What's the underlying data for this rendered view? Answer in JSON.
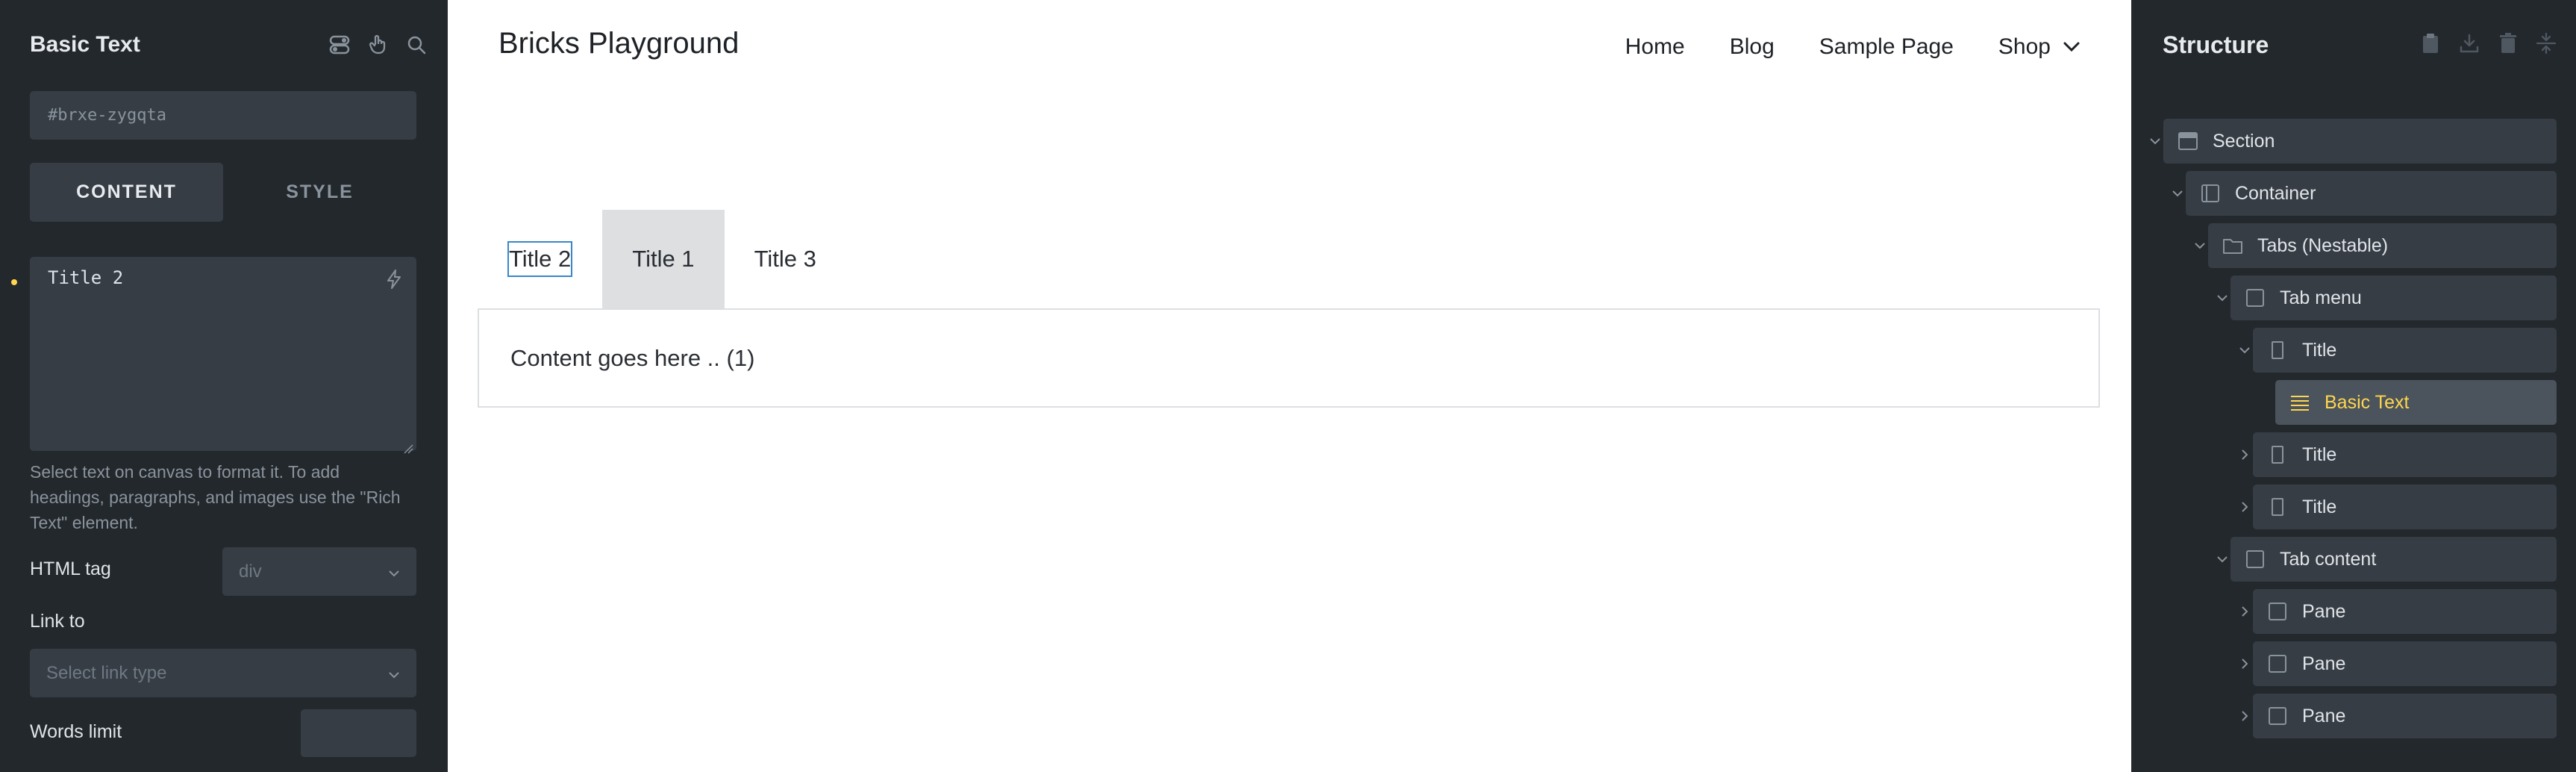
{
  "left_panel": {
    "title": "Basic Text",
    "id_placeholder": "#brxe-zygqta",
    "tabs": {
      "content": "CONTENT",
      "style": "STYLE"
    },
    "text_value": "Title 2",
    "help_text": "Select text on canvas to format it. To add headings, paragraphs, and images use the \"Rich Text\" element.",
    "html_tag_label": "HTML tag",
    "html_tag_value": "div",
    "link_to_label": "Link to",
    "link_type_placeholder": "Select link type",
    "words_limit_label": "Words limit"
  },
  "canvas": {
    "site_title": "Bricks Playground",
    "nav": [
      "Home",
      "Blog",
      "Sample Page",
      "Shop"
    ],
    "tabs": [
      "Title 2",
      "Title 1",
      "Title 3"
    ],
    "content": "Content goes here .. (1)"
  },
  "structure": {
    "title": "Structure",
    "items": [
      {
        "label": "Section"
      },
      {
        "label": "Container"
      },
      {
        "label": "Tabs (Nestable)"
      },
      {
        "label": "Tab menu"
      },
      {
        "label": "Title"
      },
      {
        "label": "Basic Text"
      },
      {
        "label": "Title"
      },
      {
        "label": "Title"
      },
      {
        "label": "Tab content"
      },
      {
        "label": "Pane"
      },
      {
        "label": "Pane"
      },
      {
        "label": "Pane"
      }
    ]
  },
  "colors": {
    "panel_bg": "#23282d",
    "field_bg": "#363d45",
    "accent_yellow": "#ffd64f",
    "active_tab_bg": "#dddfe1",
    "focus_blue": "#3a87c8"
  }
}
